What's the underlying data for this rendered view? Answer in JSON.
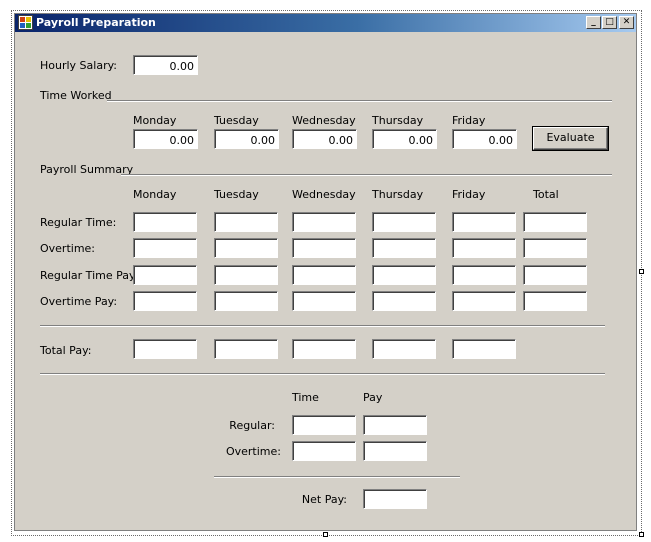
{
  "window": {
    "title": "Payroll Preparation",
    "caption_buttons": {
      "minimize": "_",
      "maximize": "□",
      "close": "✕"
    }
  },
  "hourly_salary": {
    "label": "Hourly Salary:",
    "value": "0.00"
  },
  "time_worked": {
    "label": "Time Worked",
    "days": [
      {
        "label": "Monday",
        "value": "0.00"
      },
      {
        "label": "Tuesday",
        "value": "0.00"
      },
      {
        "label": "Wednesday",
        "value": "0.00"
      },
      {
        "label": "Thursday",
        "value": "0.00"
      },
      {
        "label": "Friday",
        "value": "0.00"
      }
    ],
    "evaluate_label": "Evaluate"
  },
  "payroll_summary": {
    "label": "Payroll Summary",
    "columns": [
      "Monday",
      "Tuesday",
      "Wednesday",
      "Thursday",
      "Friday",
      "Total"
    ],
    "rows": [
      {
        "label": "Regular Time:",
        "values": [
          "",
          "",
          "",
          "",
          "",
          ""
        ]
      },
      {
        "label": "Overtime:",
        "values": [
          "",
          "",
          "",
          "",
          "",
          ""
        ]
      },
      {
        "label": "Regular Time Pay:",
        "values": [
          "",
          "",
          "",
          "",
          "",
          ""
        ]
      },
      {
        "label": "Overtime Pay:",
        "values": [
          "",
          "",
          "",
          "",
          "",
          ""
        ]
      }
    ],
    "total_pay": {
      "label": "Total Pay:",
      "values": [
        "",
        "",
        "",
        "",
        ""
      ]
    }
  },
  "summary": {
    "time_header": "Time",
    "pay_header": "Pay",
    "regular": {
      "label": "Regular:",
      "time": "",
      "pay": ""
    },
    "overtime": {
      "label": "Overtime:",
      "time": "",
      "pay": ""
    },
    "net_pay": {
      "label": "Net Pay:",
      "value": ""
    }
  }
}
